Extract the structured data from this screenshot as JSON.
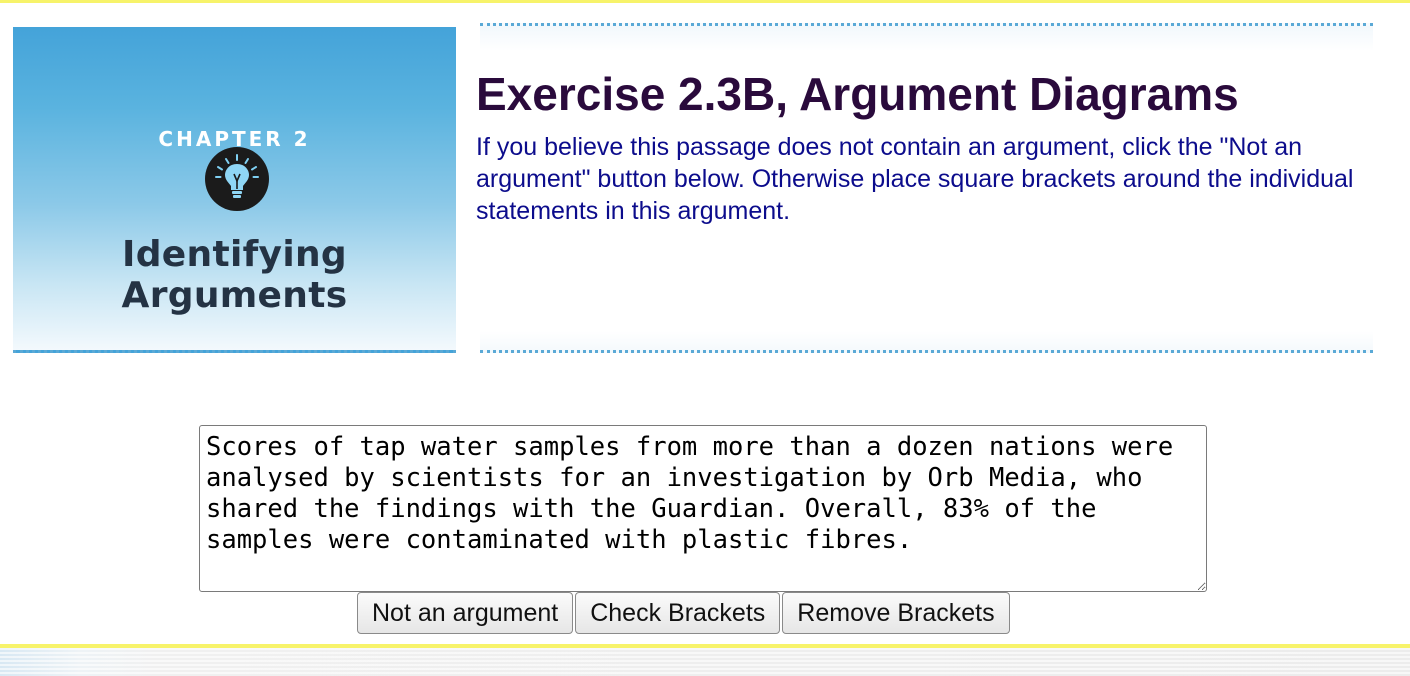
{
  "cover": {
    "chapter_label": "CHAPTER 2",
    "title": "Identifying Arguments",
    "icon": "lightbulb-icon"
  },
  "header": {
    "title": "Exercise 2.3B, Argument Diagrams",
    "instructions": "If you believe this passage does not contain an argument, click the \"Not an argument\" button below. Otherwise place square brackets around the individual statements in this argument."
  },
  "passage": {
    "text": "Scores of tap water samples from more than a dozen nations were analysed by scientists for an investigation by Orb Media, who shared the findings with the Guardian. Overall, 83% of the samples were contaminated with plastic fibres."
  },
  "buttons": {
    "not_argument": "Not an argument",
    "check": "Check Brackets",
    "remove": "Remove Brackets"
  },
  "colors": {
    "title": "#2a0a3c",
    "instructions": "#0c0c8c",
    "accent_yellow": "#f7f36a",
    "dotted_rule": "#5aa9d6"
  }
}
